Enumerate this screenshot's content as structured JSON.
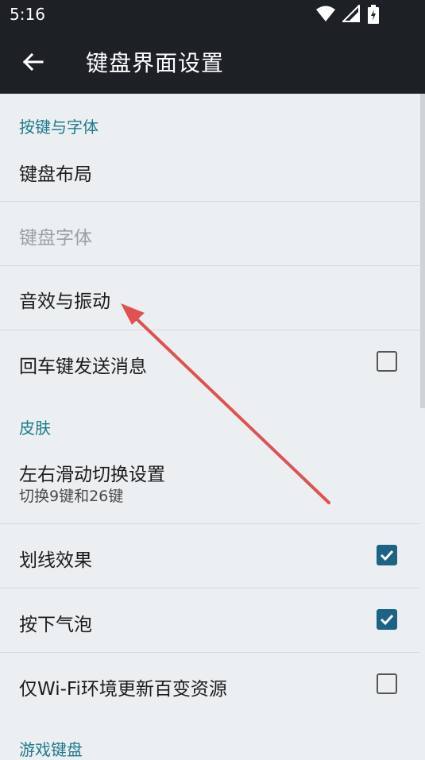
{
  "status_bar": {
    "time": "5:16"
  },
  "app_bar": {
    "title": "键盘界面设置"
  },
  "sections": {
    "keys_fonts": "按键与字体",
    "skin": "皮肤",
    "game_keyboard": "游戏键盘"
  },
  "items": {
    "keyboard_layout": "键盘布局",
    "keyboard_font": "键盘字体",
    "sound_vibration": "音效与振动",
    "enter_send": {
      "label": "回车键发送消息",
      "checked": false
    },
    "swipe_switch": {
      "label": "左右滑动切换设置",
      "summary": "切换9键和26键"
    },
    "line_effect": {
      "label": "划线效果",
      "checked": true
    },
    "press_bubble": {
      "label": "按下气泡",
      "checked": true
    },
    "wifi_update": {
      "label": "仅Wi-Fi环境更新百变资源",
      "checked": false
    }
  },
  "colors": {
    "accent": "#1f7a8c",
    "checkbox_checked": "#1c6384",
    "annotation_arrow": "#e05252",
    "bar": "#1d2125"
  }
}
